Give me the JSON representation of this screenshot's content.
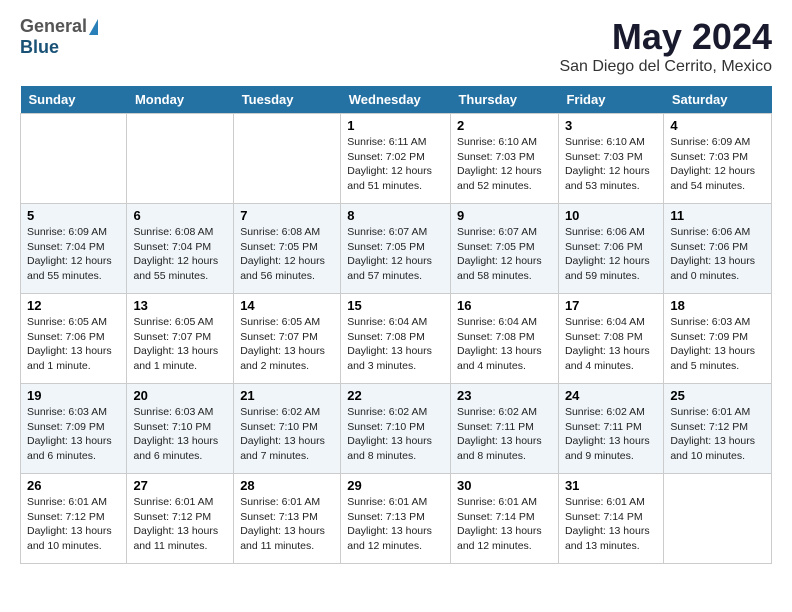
{
  "header": {
    "logo_general": "General",
    "logo_blue": "Blue",
    "title": "May 2024",
    "subtitle": "San Diego del Cerrito, Mexico"
  },
  "days_of_week": [
    "Sunday",
    "Monday",
    "Tuesday",
    "Wednesday",
    "Thursday",
    "Friday",
    "Saturday"
  ],
  "weeks": [
    [
      {
        "day": "",
        "sunrise": "",
        "sunset": "",
        "daylight": ""
      },
      {
        "day": "",
        "sunrise": "",
        "sunset": "",
        "daylight": ""
      },
      {
        "day": "",
        "sunrise": "",
        "sunset": "",
        "daylight": ""
      },
      {
        "day": "1",
        "sunrise": "Sunrise: 6:11 AM",
        "sunset": "Sunset: 7:02 PM",
        "daylight": "Daylight: 12 hours and 51 minutes."
      },
      {
        "day": "2",
        "sunrise": "Sunrise: 6:10 AM",
        "sunset": "Sunset: 7:03 PM",
        "daylight": "Daylight: 12 hours and 52 minutes."
      },
      {
        "day": "3",
        "sunrise": "Sunrise: 6:10 AM",
        "sunset": "Sunset: 7:03 PM",
        "daylight": "Daylight: 12 hours and 53 minutes."
      },
      {
        "day": "4",
        "sunrise": "Sunrise: 6:09 AM",
        "sunset": "Sunset: 7:03 PM",
        "daylight": "Daylight: 12 hours and 54 minutes."
      }
    ],
    [
      {
        "day": "5",
        "sunrise": "Sunrise: 6:09 AM",
        "sunset": "Sunset: 7:04 PM",
        "daylight": "Daylight: 12 hours and 55 minutes."
      },
      {
        "day": "6",
        "sunrise": "Sunrise: 6:08 AM",
        "sunset": "Sunset: 7:04 PM",
        "daylight": "Daylight: 12 hours and 55 minutes."
      },
      {
        "day": "7",
        "sunrise": "Sunrise: 6:08 AM",
        "sunset": "Sunset: 7:05 PM",
        "daylight": "Daylight: 12 hours and 56 minutes."
      },
      {
        "day": "8",
        "sunrise": "Sunrise: 6:07 AM",
        "sunset": "Sunset: 7:05 PM",
        "daylight": "Daylight: 12 hours and 57 minutes."
      },
      {
        "day": "9",
        "sunrise": "Sunrise: 6:07 AM",
        "sunset": "Sunset: 7:05 PM",
        "daylight": "Daylight: 12 hours and 58 minutes."
      },
      {
        "day": "10",
        "sunrise": "Sunrise: 6:06 AM",
        "sunset": "Sunset: 7:06 PM",
        "daylight": "Daylight: 12 hours and 59 minutes."
      },
      {
        "day": "11",
        "sunrise": "Sunrise: 6:06 AM",
        "sunset": "Sunset: 7:06 PM",
        "daylight": "Daylight: 13 hours and 0 minutes."
      }
    ],
    [
      {
        "day": "12",
        "sunrise": "Sunrise: 6:05 AM",
        "sunset": "Sunset: 7:06 PM",
        "daylight": "Daylight: 13 hours and 1 minute."
      },
      {
        "day": "13",
        "sunrise": "Sunrise: 6:05 AM",
        "sunset": "Sunset: 7:07 PM",
        "daylight": "Daylight: 13 hours and 1 minute."
      },
      {
        "day": "14",
        "sunrise": "Sunrise: 6:05 AM",
        "sunset": "Sunset: 7:07 PM",
        "daylight": "Daylight: 13 hours and 2 minutes."
      },
      {
        "day": "15",
        "sunrise": "Sunrise: 6:04 AM",
        "sunset": "Sunset: 7:08 PM",
        "daylight": "Daylight: 13 hours and 3 minutes."
      },
      {
        "day": "16",
        "sunrise": "Sunrise: 6:04 AM",
        "sunset": "Sunset: 7:08 PM",
        "daylight": "Daylight: 13 hours and 4 minutes."
      },
      {
        "day": "17",
        "sunrise": "Sunrise: 6:04 AM",
        "sunset": "Sunset: 7:08 PM",
        "daylight": "Daylight: 13 hours and 4 minutes."
      },
      {
        "day": "18",
        "sunrise": "Sunrise: 6:03 AM",
        "sunset": "Sunset: 7:09 PM",
        "daylight": "Daylight: 13 hours and 5 minutes."
      }
    ],
    [
      {
        "day": "19",
        "sunrise": "Sunrise: 6:03 AM",
        "sunset": "Sunset: 7:09 PM",
        "daylight": "Daylight: 13 hours and 6 minutes."
      },
      {
        "day": "20",
        "sunrise": "Sunrise: 6:03 AM",
        "sunset": "Sunset: 7:10 PM",
        "daylight": "Daylight: 13 hours and 6 minutes."
      },
      {
        "day": "21",
        "sunrise": "Sunrise: 6:02 AM",
        "sunset": "Sunset: 7:10 PM",
        "daylight": "Daylight: 13 hours and 7 minutes."
      },
      {
        "day": "22",
        "sunrise": "Sunrise: 6:02 AM",
        "sunset": "Sunset: 7:10 PM",
        "daylight": "Daylight: 13 hours and 8 minutes."
      },
      {
        "day": "23",
        "sunrise": "Sunrise: 6:02 AM",
        "sunset": "Sunset: 7:11 PM",
        "daylight": "Daylight: 13 hours and 8 minutes."
      },
      {
        "day": "24",
        "sunrise": "Sunrise: 6:02 AM",
        "sunset": "Sunset: 7:11 PM",
        "daylight": "Daylight: 13 hours and 9 minutes."
      },
      {
        "day": "25",
        "sunrise": "Sunrise: 6:01 AM",
        "sunset": "Sunset: 7:12 PM",
        "daylight": "Daylight: 13 hours and 10 minutes."
      }
    ],
    [
      {
        "day": "26",
        "sunrise": "Sunrise: 6:01 AM",
        "sunset": "Sunset: 7:12 PM",
        "daylight": "Daylight: 13 hours and 10 minutes."
      },
      {
        "day": "27",
        "sunrise": "Sunrise: 6:01 AM",
        "sunset": "Sunset: 7:12 PM",
        "daylight": "Daylight: 13 hours and 11 minutes."
      },
      {
        "day": "28",
        "sunrise": "Sunrise: 6:01 AM",
        "sunset": "Sunset: 7:13 PM",
        "daylight": "Daylight: 13 hours and 11 minutes."
      },
      {
        "day": "29",
        "sunrise": "Sunrise: 6:01 AM",
        "sunset": "Sunset: 7:13 PM",
        "daylight": "Daylight: 13 hours and 12 minutes."
      },
      {
        "day": "30",
        "sunrise": "Sunrise: 6:01 AM",
        "sunset": "Sunset: 7:14 PM",
        "daylight": "Daylight: 13 hours and 12 minutes."
      },
      {
        "day": "31",
        "sunrise": "Sunrise: 6:01 AM",
        "sunset": "Sunset: 7:14 PM",
        "daylight": "Daylight: 13 hours and 13 minutes."
      },
      {
        "day": "",
        "sunrise": "",
        "sunset": "",
        "daylight": ""
      }
    ]
  ]
}
